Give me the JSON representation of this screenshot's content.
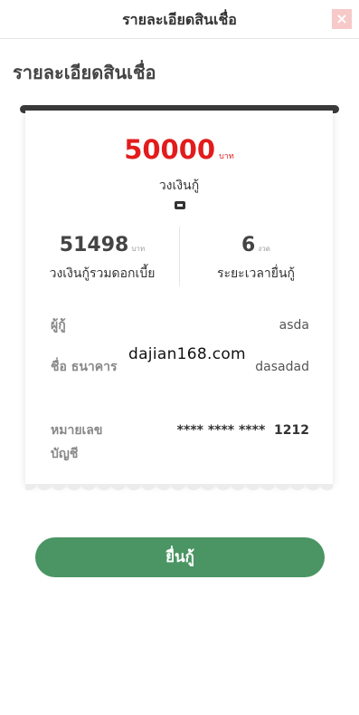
{
  "header": {
    "title": "รายละเอียดสินเชื่อ",
    "close_label": "×"
  },
  "page": {
    "heading": "รายละเอียดสินเชื่อ"
  },
  "loan": {
    "amount": "50000",
    "amount_unit": "บาท",
    "amount_label": "วงเงินกู้",
    "total": "51498",
    "total_unit": "บาท",
    "total_label": "วงเงินกู้รวมดอกเบี้ย",
    "term": "6",
    "term_unit": "งวด",
    "term_label": "ระยะเวลายื่นกู้"
  },
  "details": {
    "borrower_label": "ผู้กู้",
    "borrower_value": "asda",
    "bank_label": "ชื่อ ธนาคาร",
    "bank_value": "dasadad",
    "account_label": "หมายเลข บัญชี",
    "account_value": "**** **** ****  1212"
  },
  "watermark": "dajian168.com",
  "actions": {
    "submit_label": "ยื่นกู้"
  },
  "colors": {
    "accent_red": "#e21c1c",
    "button_green": "#4a9563"
  },
  "icons": {
    "ticket": "ticket-icon",
    "close": "close-icon"
  }
}
